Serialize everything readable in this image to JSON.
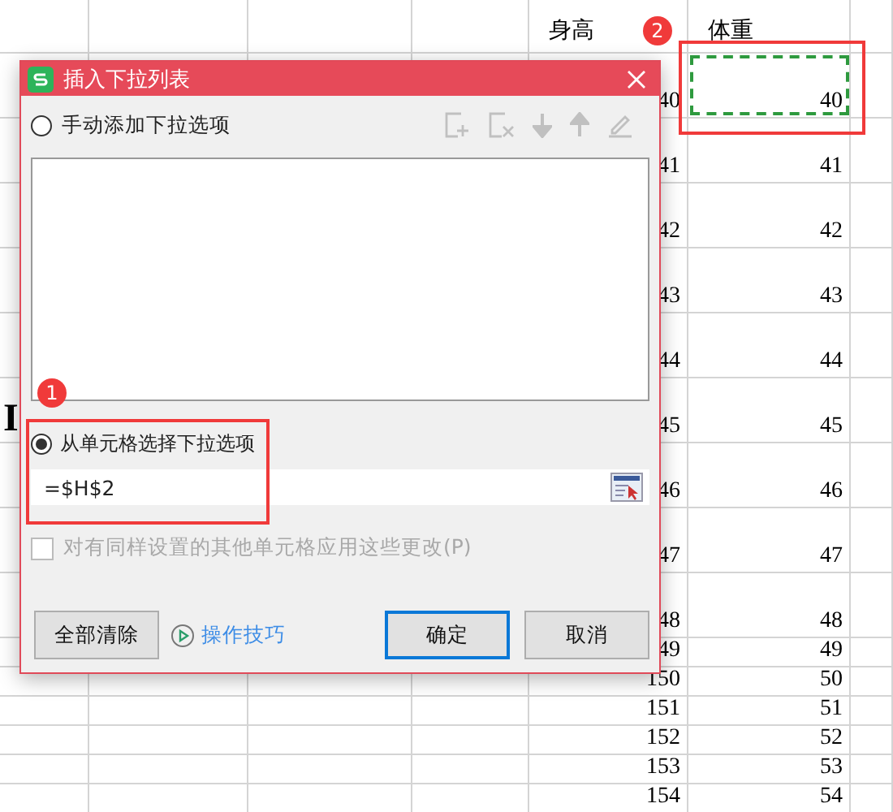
{
  "sheet": {
    "column_e_header": "身高",
    "column_f_header": "体重",
    "rows": [
      {
        "column_e": "40",
        "column_f": "40",
        "selected": true
      },
      {
        "column_e": "41",
        "column_f": "41",
        "selected": false
      },
      {
        "column_e": "42",
        "column_f": "42",
        "selected": false
      },
      {
        "column_e": "43",
        "column_f": "43",
        "selected": false
      },
      {
        "column_e": "44",
        "column_f": "44",
        "selected": false
      },
      {
        "column_a": "I",
        "column_e": "45",
        "column_f": "45",
        "selected": false
      },
      {
        "column_e": "46",
        "column_f": "46",
        "selected": false
      },
      {
        "column_e": "47",
        "column_f": "47",
        "selected": false
      },
      {
        "column_e": "48",
        "column_f": "48",
        "selected": false
      },
      {
        "column_e": "49",
        "column_f": "49",
        "selected": false
      },
      {
        "column_e": "150",
        "column_f": "50",
        "selected": false
      },
      {
        "column_e": "151",
        "column_f": "51",
        "selected": false
      },
      {
        "column_e": "152",
        "column_f": "52",
        "selected": false
      },
      {
        "column_e": "153",
        "column_f": "53",
        "selected": false
      },
      {
        "column_e": "154",
        "column_f": "54",
        "selected": false
      }
    ]
  },
  "annotations": [
    {
      "number": "1"
    },
    {
      "number": "2"
    }
  ],
  "dialog": {
    "title": "插入下拉列表",
    "options": [
      {
        "label": "手动添加下拉选项",
        "selected": false
      },
      {
        "label": "从单元格选择下拉选项",
        "selected": true
      }
    ],
    "toolbar_disabled": true,
    "source_field": {
      "value": "=$H$2"
    },
    "apply_checkbox": {
      "label": "对有同样设置的其他单元格应用这些更改(P)",
      "checked": false,
      "disabled": true
    },
    "clear_button": "全部清除",
    "tips_link": "操作技巧",
    "ok_button": "确定",
    "cancel_button": "取消"
  }
}
